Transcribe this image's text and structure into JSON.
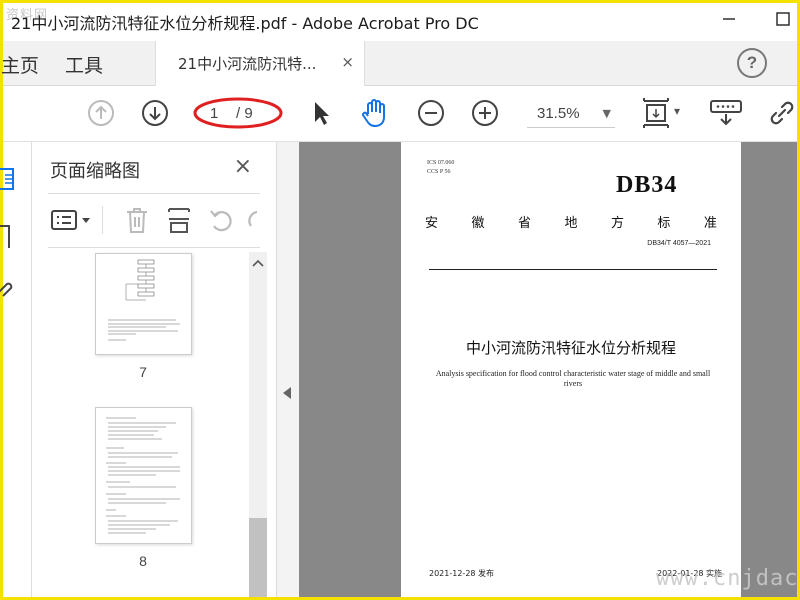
{
  "watermark": "资料网",
  "window": {
    "title": "21中小河流防汛特征水位分析规程.pdf - Adobe Acrobat Pro DC",
    "minimize_glyph": "□",
    "maximize_glyph": "□"
  },
  "tabs": {
    "home": "主页",
    "tools": "工具",
    "doc": "21中小河流防汛特...",
    "close": "×",
    "help": "?"
  },
  "toolbar": {
    "page_current": "1",
    "page_total": "/ 9",
    "zoom": "31.5%",
    "zoom_arrow": "▼",
    "dropdown_arrow": "▾"
  },
  "panel": {
    "title": "页面缩略图",
    "close": "×",
    "thumbnails": [
      {
        "number": "7"
      },
      {
        "number": "8"
      }
    ]
  },
  "page": {
    "ics": "ICS  07.060",
    "ccs": "CCS  P  56",
    "db": "DB34",
    "province_chars": [
      "安",
      "徽",
      "省",
      "地",
      "方",
      "标",
      "准"
    ],
    "std_number": "DB34/T  4057—2021",
    "title_cn": "中小河流防汛特征水位分析规程",
    "title_en": "Analysis specification for flood control characteristic water stage of middle and small rivers",
    "release": "2021-12-28 发布",
    "implement": "2022-01-28 实施"
  },
  "corner_watermark": "www.cnjdac"
}
